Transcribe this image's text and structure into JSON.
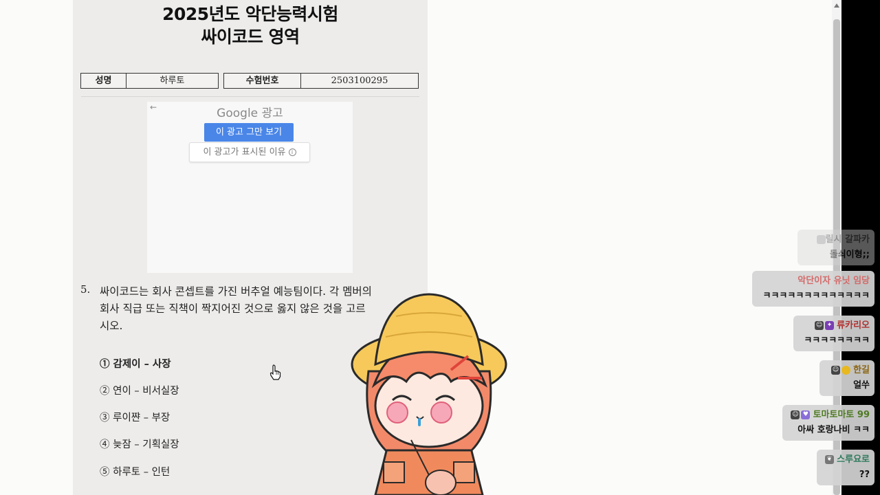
{
  "exam": {
    "title_line1": "2025년도 악단능력시험",
    "title_line2": "싸이코드 영역",
    "info": {
      "name_label": "성명",
      "name_value": "하루토",
      "id_label": "수험번호",
      "id_value": "2503100295"
    }
  },
  "ad": {
    "back_icon": "←",
    "brand": "Google 광고",
    "stop_label": "이 광고 그만 보기",
    "why_label": "이 광고가 표시된 이유",
    "info_icon": "i"
  },
  "question": {
    "number": "5.",
    "line1": "싸이코드는 회사 콘셉트를 가진 버추얼 예능팀이다. 각 멤버의",
    "line2": "회사 직급 또는 직책이 짝지어진 것으로 옳지 않은 것을 고르",
    "line3": "시오.",
    "choices": [
      "① 감제이 – 사장",
      "② 연이 – 비서실장",
      "③ 루이쨘 – 부장",
      "④ 늦잠 – 기획실장",
      "⑤ 하루토 – 인턴"
    ]
  },
  "chat": [
    {
      "user": "릴시 갈파카",
      "text": "돌쇠이형;;",
      "color": "#666666"
    },
    {
      "user": "악단이자 유닛 임당",
      "text": "ㅋㅋㅋㅋㅋㅋㅋㅋㅋㅋㅋㅋㅋ",
      "color": "#d46a6a"
    },
    {
      "user": "류카리오",
      "text": "ㅋㅋㅋㅋㅋㅋㅋㅋ",
      "color": "#b03030"
    },
    {
      "user": "한길",
      "text": "얼쑤",
      "color": "#c8961e"
    },
    {
      "user": "토마토마토 99",
      "text": "아싸 호랑나비 ㅋㅋ",
      "color": "#6a8e3a"
    },
    {
      "user": "스루요로",
      "text": "??",
      "color": "#3c8c6e"
    }
  ],
  "colors": {
    "paper": "#edeceb",
    "ad_button": "#4a86e8",
    "scrollbar_thumb": "#c1c1c1"
  }
}
